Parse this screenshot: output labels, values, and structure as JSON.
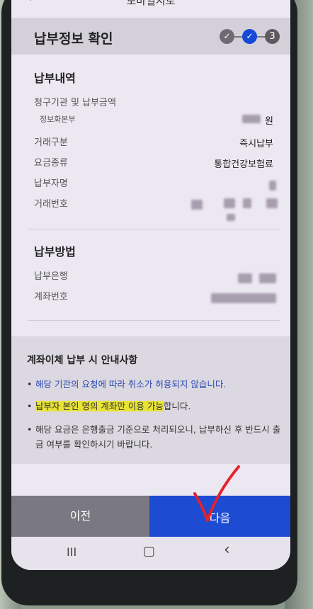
{
  "appbar": {
    "back_icon": "arrow-left-icon",
    "title": "모바일지로"
  },
  "page": {
    "title": "납부정보 확인"
  },
  "stepper": {
    "steps": [
      "✓",
      "✓",
      "3"
    ],
    "colors": {
      "done": "#6e6c72",
      "active": "#1549d6"
    }
  },
  "payment_details": {
    "title": "납부내역",
    "rows": [
      {
        "label": "청구기관 및 납부금액",
        "value": ""
      },
      {
        "label": "정보화본부",
        "value": "원"
      },
      {
        "label": "거래구분",
        "value": "즉시납부"
      },
      {
        "label": "요금종류",
        "value": "통합건강보험료"
      },
      {
        "label": "납부자명",
        "value": ""
      },
      {
        "label": "거래번호",
        "value": ""
      }
    ]
  },
  "payment_method": {
    "title": "납부방법",
    "rows": [
      {
        "label": "납부은행",
        "value": ""
      },
      {
        "label": "계좌번호",
        "value": ""
      }
    ]
  },
  "notice": {
    "title": "계좌이체 납부 시 안내사항",
    "items": [
      "해당 기관의 요청에 따라 취소가 허용되지 않습니다.",
      "납부자 본인 명의 계좌만 이용 가능합니다.",
      "해당 요금은 은행출금 기준으로 처리되오니, 납부하신 후 반드시 출금 여부를 확인하시기 바랍니다."
    ],
    "highlight_text": "납부자 본인 명의 계좌만 이용 가능",
    "highlight_rest": "합니다."
  },
  "buttons": {
    "prev": "이전",
    "next": "다음"
  },
  "navbar": {
    "recent": "III",
    "home": "▢",
    "back": "‹"
  }
}
